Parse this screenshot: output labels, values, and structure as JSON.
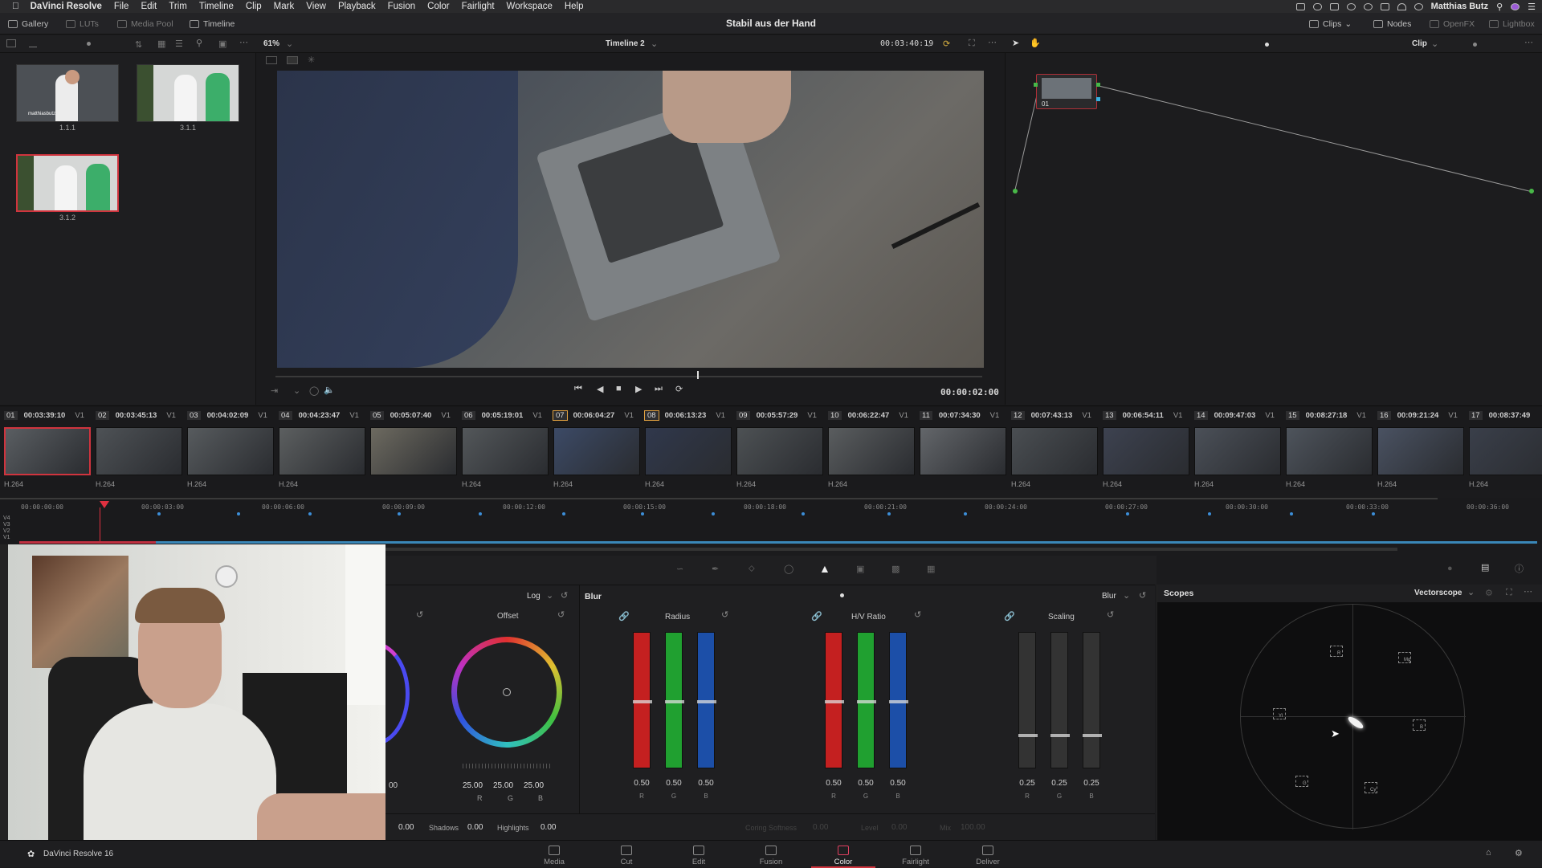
{
  "menubar": {
    "app": "DaVinci Resolve",
    "items": [
      "File",
      "Edit",
      "Trim",
      "Timeline",
      "Clip",
      "Mark",
      "View",
      "Playback",
      "Fusion",
      "Color",
      "Fairlight",
      "Workspace",
      "Help"
    ],
    "user": "Matthias Butz"
  },
  "titlebar": {
    "gallery": "Gallery",
    "luts": "LUTs",
    "media_pool": "Media Pool",
    "timeline": "Timeline",
    "project_title": "Stabil aus der Hand",
    "clips": "Clips",
    "nodes": "Nodes",
    "openfx": "OpenFX",
    "lightbox": "Lightbox"
  },
  "viewer_bar": {
    "zoom": "61%",
    "timeline_name": "Timeline 2",
    "timecode": "00:03:40:19",
    "clip_mode": "Clip"
  },
  "gallery": {
    "stills": [
      {
        "label": "1.1.1"
      },
      {
        "label": "3.1.1"
      },
      {
        "label": "3.1.2"
      }
    ],
    "still_overlay_text": "matthiasbutz"
  },
  "viewer": {
    "current_tc": "00:00:02:00"
  },
  "node": {
    "label": "01"
  },
  "clips": [
    {
      "num": "01",
      "tc": "00:03:39:10",
      "track": "V1",
      "codec": "H.264"
    },
    {
      "num": "02",
      "tc": "00:03:45:13",
      "track": "V1",
      "codec": "H.264"
    },
    {
      "num": "03",
      "tc": "00:04:02:09",
      "track": "V1",
      "codec": "H.264"
    },
    {
      "num": "04",
      "tc": "00:04:23:47",
      "track": "V1",
      "codec": "H.264"
    },
    {
      "num": "05",
      "tc": "00:05:07:40",
      "track": "V1",
      "codec": ""
    },
    {
      "num": "06",
      "tc": "00:05:19:01",
      "track": "V1",
      "codec": "H.264"
    },
    {
      "num": "07",
      "tc": "00:06:04:27",
      "track": "V1",
      "codec": "H.264"
    },
    {
      "num": "08",
      "tc": "00:06:13:23",
      "track": "V1",
      "codec": "H.264"
    },
    {
      "num": "09",
      "tc": "00:05:57:29",
      "track": "V1",
      "codec": "H.264"
    },
    {
      "num": "10",
      "tc": "00:06:22:47",
      "track": "V1",
      "codec": "H.264"
    },
    {
      "num": "11",
      "tc": "00:07:34:30",
      "track": "V1",
      "codec": ""
    },
    {
      "num": "12",
      "tc": "00:07:43:13",
      "track": "V1",
      "codec": "H.264"
    },
    {
      "num": "13",
      "tc": "00:06:54:11",
      "track": "V1",
      "codec": "H.264"
    },
    {
      "num": "14",
      "tc": "00:09:47:03",
      "track": "V1",
      "codec": "H.264"
    },
    {
      "num": "15",
      "tc": "00:08:27:18",
      "track": "V1",
      "codec": "H.264"
    },
    {
      "num": "16",
      "tc": "00:09:21:24",
      "track": "V1",
      "codec": "H.264"
    },
    {
      "num": "17",
      "tc": "00:08:37:49",
      "track": "",
      "codec": "H.264"
    }
  ],
  "mini_timeline": {
    "ruler": [
      "00:00:00:00",
      "00:00:03:00",
      "00:00:06:00",
      "00:00:09:00",
      "00:00:12:00",
      "00:00:15:00",
      "00:00:18:00",
      "00:00:21:00",
      "00:00:24:00",
      "00:00:27:00",
      "00:00:30:00",
      "00:00:33:00",
      "00:00:36:00"
    ],
    "tracks": [
      "V4",
      "V3",
      "V2",
      "V1"
    ]
  },
  "color_panel": {
    "log_mode": "Log",
    "offset_label": "Offset",
    "offset_values": [
      "25.00",
      "25.00",
      "25.00"
    ],
    "offset_channel_labels": [
      "R",
      "G",
      "B"
    ],
    "left_partial_value": "00",
    "blur_title": "Blur",
    "blur_mode": "Blur",
    "radius_label": "Radius",
    "radius_values": [
      "0.50",
      "0.50",
      "0.50"
    ],
    "hv_label": "H/V Ratio",
    "hv_values": [
      "0.50",
      "0.50",
      "0.50"
    ],
    "scaling_label": "Scaling",
    "scaling_values": [
      "0.25",
      "0.25",
      "0.25"
    ],
    "channel_labels": [
      "R",
      "G",
      "B"
    ],
    "bottom_row": {
      "first_value": "0.00",
      "shadows_label": "Shadows",
      "shadows_value": "0.00",
      "highlights_label": "Highlights",
      "highlights_value": "0.00",
      "coring_label": "Coring Softness",
      "coring_value": "0.00",
      "level_label": "Level",
      "level_value": "0.00",
      "mix_label": "Mix",
      "mix_value": "100.00"
    }
  },
  "scopes": {
    "title": "Scopes",
    "mode": "Vectorscope",
    "targets": [
      "R",
      "Mg",
      "B",
      "Cy",
      "G",
      "Yl"
    ]
  },
  "pages": [
    "Media",
    "Cut",
    "Edit",
    "Fusion",
    "Color",
    "Fairlight",
    "Deliver"
  ],
  "active_page": "Color",
  "footer": {
    "app_version": "DaVinci Resolve 16"
  }
}
